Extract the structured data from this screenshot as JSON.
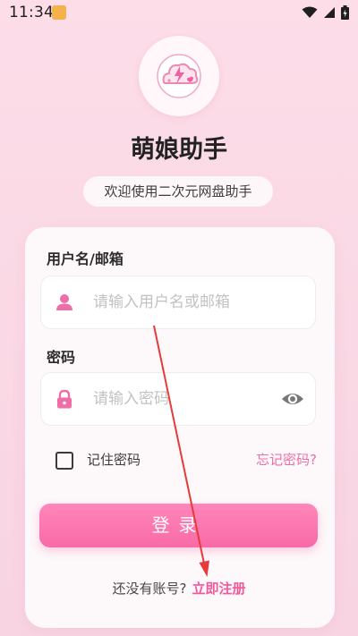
{
  "status_bar": {
    "time": "11:34"
  },
  "app": {
    "title": "萌娘助手",
    "subtitle": "欢迎使用二次元网盘助手"
  },
  "form": {
    "username_label": "用户名/邮箱",
    "username_placeholder": "请输入用户名或邮箱",
    "password_label": "密码",
    "password_placeholder": "请输入密码",
    "remember_label": "记住密码",
    "forgot_label": "忘记密码?",
    "login_label": "登录",
    "no_account_label": "还没有账号?",
    "register_label": "立即注册"
  },
  "colors": {
    "accent": "#f86aa6",
    "annotation_arrow": "#e63b3b"
  },
  "icons": [
    "status-app-icon",
    "wifi-icon",
    "signal-icon",
    "battery-icon",
    "logo-icon",
    "user-icon",
    "lock-icon",
    "eye-icon"
  ]
}
